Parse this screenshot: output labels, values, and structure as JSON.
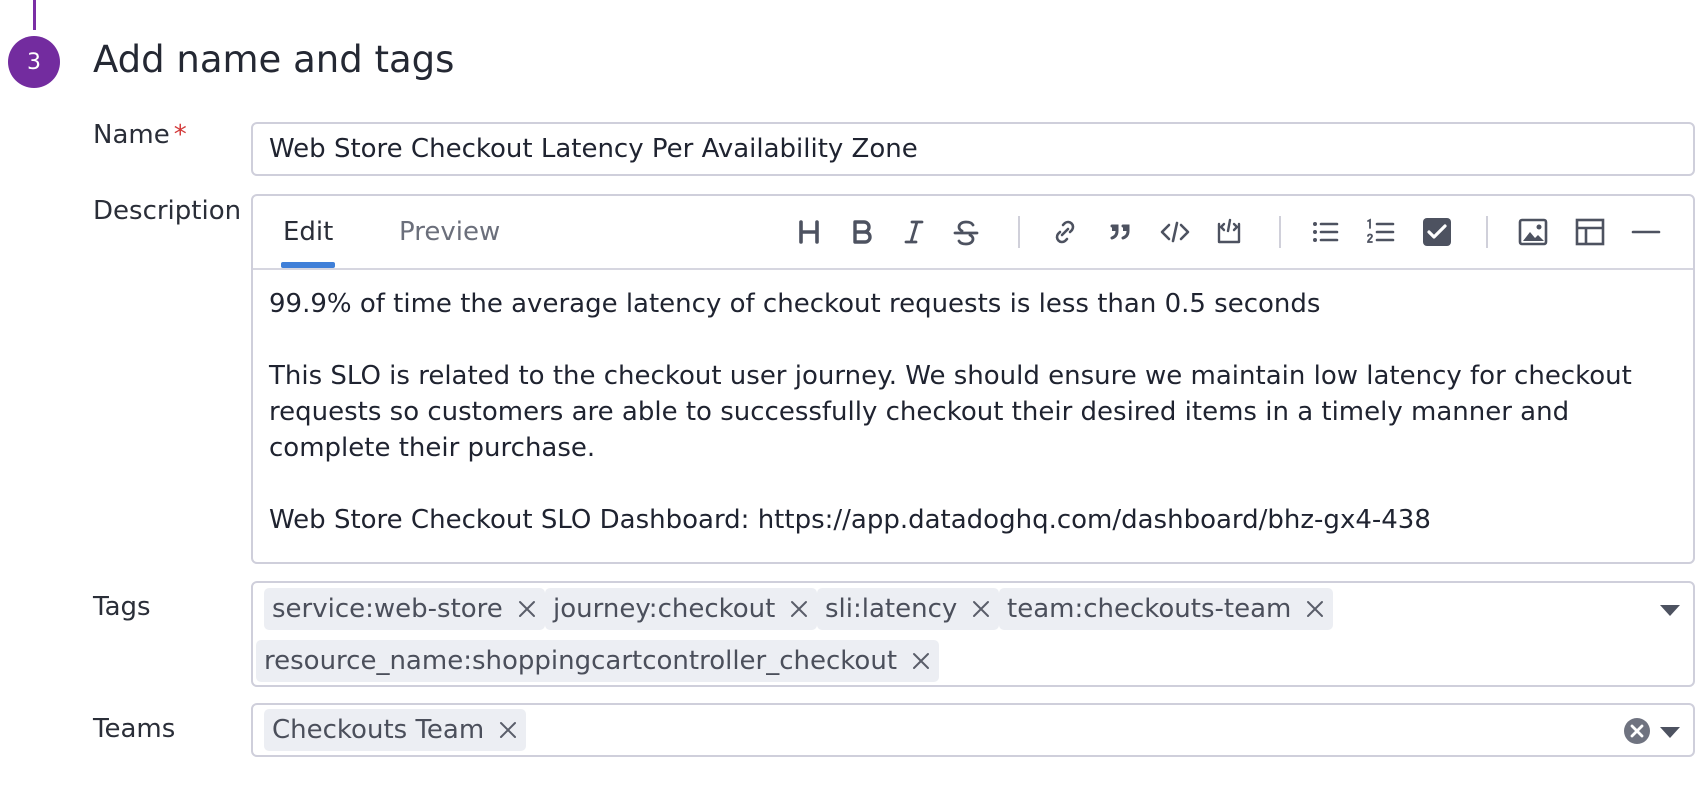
{
  "step": {
    "number": "3",
    "title": "Add name and tags"
  },
  "name_field": {
    "label": "Name",
    "required_mark": "*",
    "value": "Web Store Checkout Latency Per Availability Zone"
  },
  "description": {
    "label": "Description",
    "tabs": {
      "edit": "Edit",
      "preview": "Preview",
      "active": "Edit"
    },
    "toolbar_icons": [
      "heading-icon",
      "bold-icon",
      "italic-icon",
      "strikethrough-icon",
      "link-icon",
      "quote-icon",
      "code-icon",
      "code-block-icon",
      "bullet-list-icon",
      "numbered-list-icon",
      "task-list-icon",
      "image-icon",
      "table-icon",
      "horizontal-rule-icon"
    ],
    "content": {
      "line1": "99.9% of time the average latency of checkout requests is less than 0.5 seconds",
      "line2": "This SLO is related to the checkout user journey. We should ensure we maintain low latency for checkout requests so customers are able to successfully checkout their desired items in a timely manner and complete their purchase.",
      "line3": "Web Store Checkout SLO Dashboard: https://app.datadoghq.com/dashboard/bhz-gx4-438"
    }
  },
  "tags": {
    "label": "Tags",
    "items": [
      "service:web-store",
      "journey:checkout",
      "sli:latency",
      "team:checkouts-team",
      "resource_name:shoppingcartcontroller_checkout"
    ]
  },
  "teams": {
    "label": "Teams",
    "items": [
      "Checkouts Team"
    ]
  },
  "colors": {
    "accent_purple": "#732c9f",
    "active_tab": "#3f7fd8",
    "required": "#d33a3a",
    "chip_bg": "#eceef3"
  }
}
